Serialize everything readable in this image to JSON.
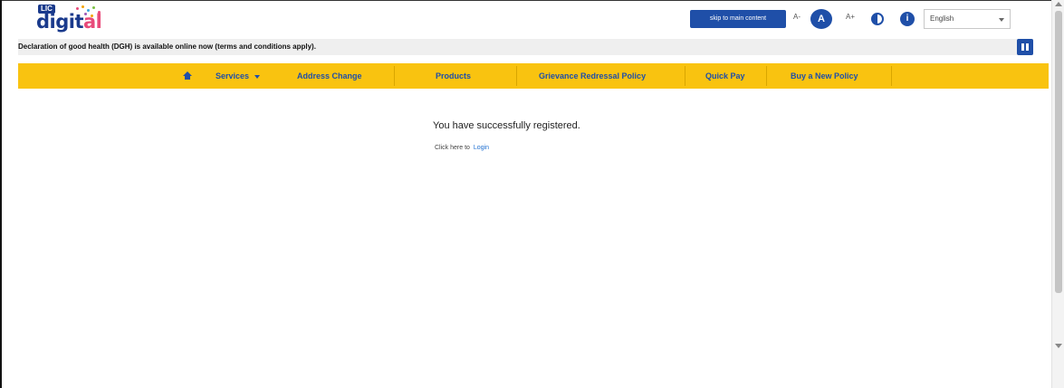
{
  "header": {
    "logo": {
      "top_text": "LIC",
      "word_main": "digit",
      "word_accent": "al"
    },
    "skip_label": "skip to main content",
    "font_small": "A-",
    "font_normal": "A",
    "font_large": "A+",
    "language": {
      "selected": "English"
    }
  },
  "announcement": {
    "text": "Declaration of good health (DGH) is available online now (terms and conditions apply)."
  },
  "nav": {
    "items": [
      {
        "label": "Services",
        "has_dropdown": true
      },
      {
        "label": "Address Change"
      },
      {
        "label": "Products"
      },
      {
        "label": "Grievance Redressal Policy"
      },
      {
        "label": "Quick Pay"
      },
      {
        "label": "Buy a New Policy"
      }
    ]
  },
  "main": {
    "message": "You have successfully registered.",
    "prompt": "Click here to",
    "login_label": "Login"
  },
  "colors": {
    "brand_blue": "#1f4fa8",
    "nav_yellow": "#f9c310",
    "link_blue": "#1f6fd0"
  },
  "icons": [
    "home-icon",
    "chevron-down-icon",
    "contrast-icon",
    "accessibility-icon",
    "pause-icon"
  ]
}
